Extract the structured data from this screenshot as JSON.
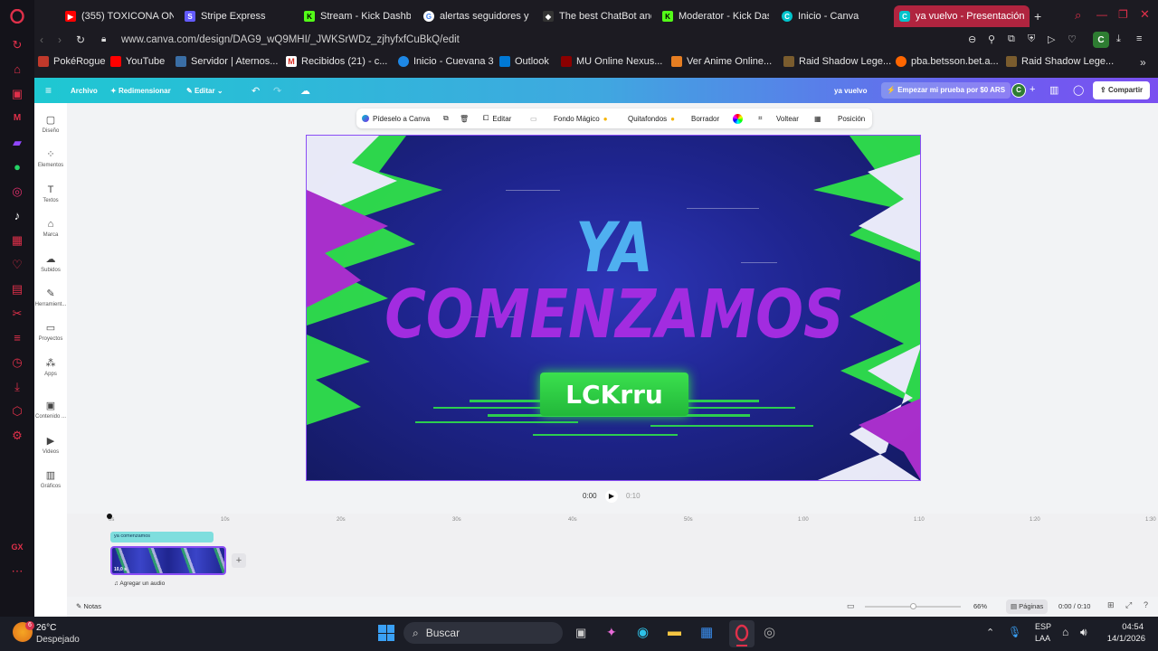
{
  "browser": {
    "tabs": [
      {
        "label": "(355) TOXICONA ON…",
        "color": "#ff0000"
      },
      {
        "label": "Stripe Express",
        "color": "#635bff"
      },
      {
        "label": "Stream - Kick Dashbo",
        "color": "#53fc18"
      },
      {
        "label": "alertas seguidores y…",
        "color": "#4285f4"
      },
      {
        "label": "The best ChatBot and…",
        "color": "#ffffff"
      },
      {
        "label": "Moderator - Kick Das…",
        "color": "#53fc18"
      },
      {
        "label": "Inicio - Canva",
        "color": "#00c4cc"
      },
      {
        "label": "ya vuelvo - Presentación",
        "color": "#00c4cc"
      }
    ],
    "url": "www.canva.com/design/DAG9_wQ9MHI/_JWKSrWDz_zjhyfxfCuBkQ/edit",
    "bookmarks": [
      "PokéRogue",
      "YouTube",
      "Servidor | Aternos...",
      "Recibidos (21) - c...",
      "Inicio - Cuevana 3",
      "Outlook",
      "MU Online Nexus...",
      "Ver Anime Online...",
      "Raid Shadow Lege...",
      "pba.betsson.bet.a...",
      "Raid Shadow Lege..."
    ],
    "profile_initial": "C"
  },
  "canva": {
    "header": {
      "archivo": "Archivo",
      "redimensionar": "Redimensionar",
      "editar": "Editar",
      "design_title": "ya vuelvo",
      "trial": "Empezar mi prueba por $0 ARS",
      "avatar": "C",
      "compartir": "Compartir"
    },
    "left_rail": [
      "Diseño",
      "Elementos",
      "Textos",
      "Marca",
      "Subidos",
      "Herramient...",
      "Proyectos",
      "Apps",
      "Contenido ...",
      "Videos",
      "Gráficos"
    ],
    "toolbar": {
      "pideselo": "Pídeselo a Canva",
      "editar": "Editar",
      "fondo": "Fondo Mágico",
      "quitafondos": "Quitafondos",
      "borrador": "Borrador",
      "voltear": "Voltear",
      "posicion": "Posición"
    },
    "slide": {
      "line1": "YA",
      "line2": "COMENZAMOS",
      "badge": "LCKrru"
    },
    "playback": {
      "current": "0:00",
      "total": "0:10"
    },
    "ruler": [
      "0s",
      "10s",
      "20s",
      "30s",
      "40s",
      "50s",
      "1:00",
      "1:10",
      "1:20",
      "1:30"
    ],
    "clip_label": "ya comenzamos",
    "clip_duration": "10,0 s",
    "add_audio": "Agregar un audio",
    "notes": "Notas",
    "zoom": "66%",
    "pages": "Páginas",
    "time_ratio": "0:00 / 0:10"
  },
  "taskbar": {
    "weather_temp": "26°C",
    "weather_desc": "Despejado",
    "weather_badge": "6",
    "search": "Buscar",
    "lang1": "ESP",
    "lang2": "LAA",
    "time": "04:54",
    "date": "14/1/2026"
  }
}
